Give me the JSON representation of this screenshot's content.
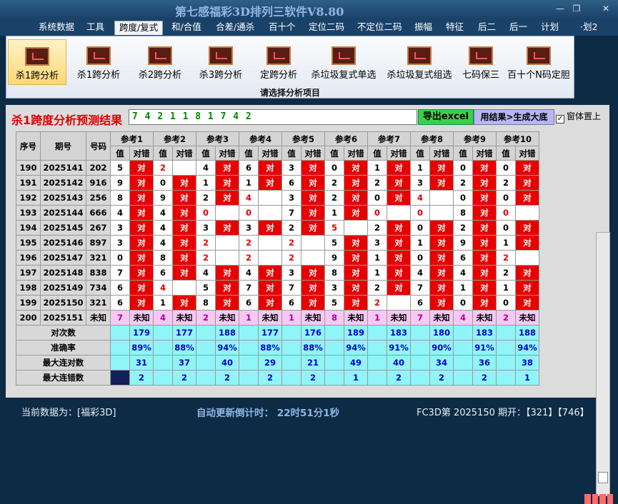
{
  "window": {
    "title": "第七感福彩3D排列三软件V8.80",
    "min": "—",
    "restore": "❐",
    "close": "✕"
  },
  "menu": [
    "系统数据",
    "工具",
    "跨度/复式",
    "和/合值",
    "合差/通杀",
    "百十个",
    "定位二码",
    "不定位二码",
    "振幅",
    "特征",
    "后二",
    "后一",
    "计划",
    "·划2"
  ],
  "ribbon": {
    "buttons": [
      "杀1跨分析",
      "杀1跨分析",
      "杀2跨分析",
      "杀3跨分析",
      "定跨分析",
      "杀垃圾复式单选",
      "杀垃圾复式组选",
      "七码保三",
      "百十个N码定胆"
    ],
    "footer": "请选择分析项目"
  },
  "panel": {
    "title": "杀1跨度分析预测结果",
    "result": "7 4 2 1 1 8 1 7 4 2",
    "export_label": "导出excel",
    "generate_label": "用结果>生成大底",
    "ontop_label": "窗体置上",
    "ontop_checked": "✓"
  },
  "table": {
    "headers": {
      "seq": "序号",
      "issue": "期号",
      "number": "号码",
      "refs": [
        "参考1",
        "参考2",
        "参考3",
        "参考4",
        "参考5",
        "参考6",
        "参考7",
        "参考8",
        "参考9",
        "参考10"
      ],
      "value": "值",
      "result": "对错"
    },
    "ok_label": "对",
    "rows": [
      {
        "seq": "190",
        "issue": "2025141",
        "number": "202",
        "values": [
          "5",
          "2",
          "4",
          "6",
          "3",
          "0",
          "1",
          "1",
          "0",
          "0"
        ]
      },
      {
        "seq": "191",
        "issue": "2025142",
        "number": "916",
        "values": [
          "9",
          "0",
          "1",
          "1",
          "6",
          "2",
          "2",
          "3",
          "2",
          "2"
        ]
      },
      {
        "seq": "192",
        "issue": "2025143",
        "number": "256",
        "values": [
          "8",
          "9",
          "2",
          "4",
          "3",
          "2",
          "0",
          "4",
          "0",
          "0"
        ]
      },
      {
        "seq": "193",
        "issue": "2025144",
        "number": "666",
        "values": [
          "4",
          "4",
          "0",
          "0",
          "7",
          "1",
          "0",
          "0",
          "8",
          "0"
        ]
      },
      {
        "seq": "194",
        "issue": "2025145",
        "number": "267",
        "values": [
          "3",
          "4",
          "3",
          "3",
          "2",
          "5",
          "2",
          "0",
          "2",
          "0"
        ]
      },
      {
        "seq": "195",
        "issue": "2025146",
        "number": "897",
        "values": [
          "3",
          "4",
          "2",
          "2",
          "2",
          "5",
          "3",
          "1",
          "9",
          "1"
        ]
      },
      {
        "seq": "196",
        "issue": "2025147",
        "number": "321",
        "values": [
          "0",
          "8",
          "2",
          "2",
          "2",
          "9",
          "1",
          "0",
          "6",
          "2"
        ]
      },
      {
        "seq": "197",
        "issue": "2025148",
        "number": "838",
        "values": [
          "7",
          "6",
          "4",
          "4",
          "3",
          "8",
          "1",
          "4",
          "4",
          "2"
        ]
      },
      {
        "seq": "198",
        "issue": "2025149",
        "number": "734",
        "values": [
          "6",
          "4",
          "5",
          "7",
          "7",
          "3",
          "2",
          "7",
          "1",
          "1"
        ]
      },
      {
        "seq": "199",
        "issue": "2025150",
        "number": "321",
        "values": [
          "6",
          "1",
          "8",
          "6",
          "6",
          "5",
          "2",
          "6",
          "0",
          "0"
        ]
      }
    ],
    "pending": {
      "seq": "200",
      "issue": "2025151",
      "number": "未知",
      "values": [
        "7",
        "4",
        "2",
        "1",
        "1",
        "8",
        "1",
        "7",
        "4",
        "2"
      ],
      "result": "未知"
    },
    "stats": [
      {
        "label": "对次数",
        "values": [
          "179",
          "177",
          "188",
          "177",
          "176",
          "189",
          "183",
          "180",
          "183",
          "188"
        ]
      },
      {
        "label": "准确率",
        "values": [
          "89%",
          "88%",
          "94%",
          "88%",
          "88%",
          "94%",
          "91%",
          "90%",
          "91%",
          "94%"
        ]
      },
      {
        "label": "最大连对数",
        "values": [
          "31",
          "37",
          "40",
          "29",
          "21",
          "49",
          "40",
          "34",
          "36",
          "38"
        ]
      },
      {
        "label": "最大连错数",
        "values": [
          "2",
          "2",
          "2",
          "2",
          "2",
          "1",
          "2",
          "2",
          "2",
          "1"
        ]
      }
    ]
  },
  "statusbar": {
    "data_source": "当前数据为：[福彩3D]",
    "countdown": "自动更新倒计时：  22时51分1秒",
    "draw": "FC3D第 2025150 期开：【321】【746】"
  },
  "colors": {
    "hit": "#e80000",
    "pending": "#f7c8f4",
    "stats": "#8ff5f9",
    "title_red": "#e00000"
  }
}
